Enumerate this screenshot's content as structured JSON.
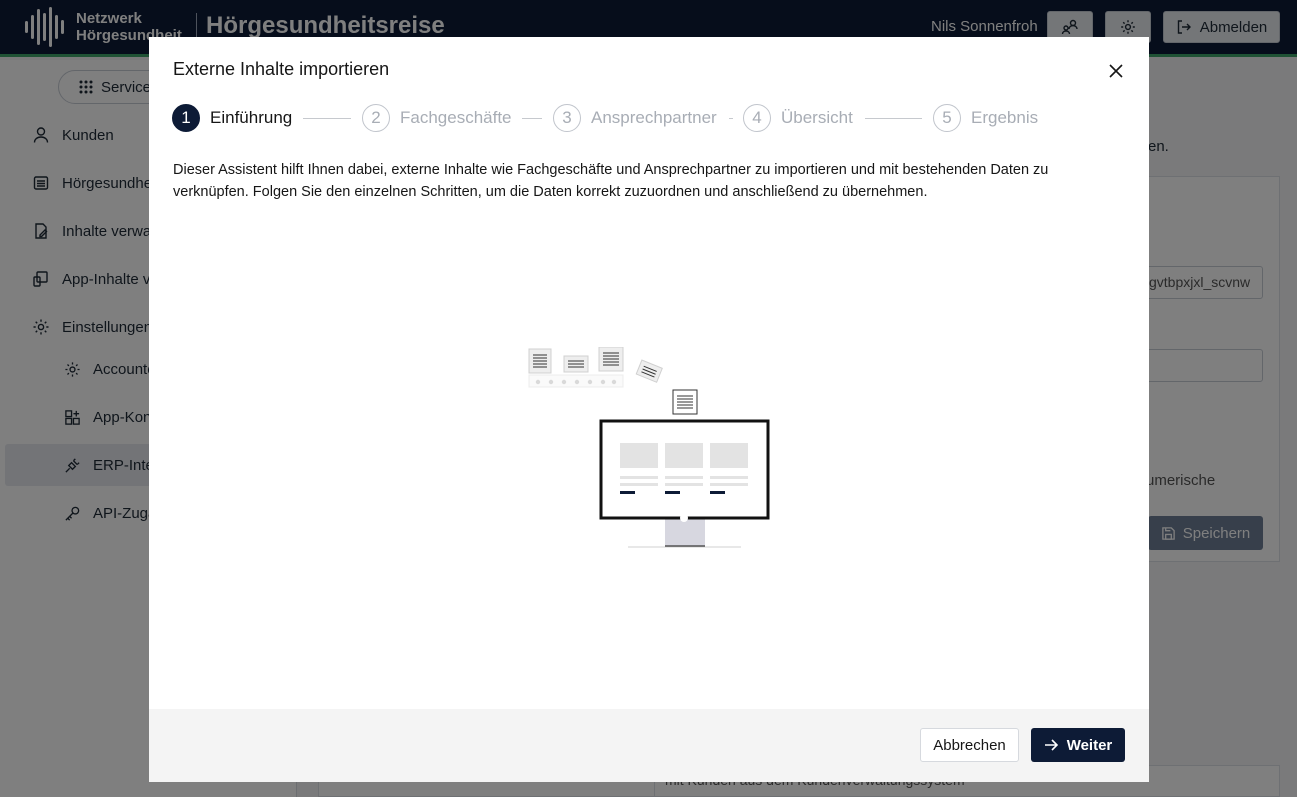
{
  "header": {
    "logo_line1": "Netzwerk",
    "logo_line2": "Hörgesundheit",
    "app_title": "Hörgesundheitsreise",
    "user_name": "Nils Sonnenfroh",
    "logout_label": "Abmelden"
  },
  "sidebar": {
    "service_label": "Service",
    "items": [
      {
        "label": "Kunden",
        "icon": "user-icon"
      },
      {
        "label": "Hörgesundhe",
        "icon": "list-icon"
      },
      {
        "label": "Inhalte verwal",
        "icon": "edit-document-icon"
      },
      {
        "label": "App-Inhalte ve",
        "icon": "app-content-icon"
      },
      {
        "label": "Einstellungen",
        "icon": "gear-icon"
      }
    ],
    "sub_items": [
      {
        "label": "Accounte",
        "icon": "gear-icon"
      },
      {
        "label": "App-Kon",
        "icon": "app-add-icon"
      },
      {
        "label": "ERP-Inte",
        "icon": "plug-icon",
        "active": true
      },
      {
        "label": "API-Zugä",
        "icon": "key-icon"
      }
    ]
  },
  "background": {
    "text_fragment": "en.",
    "input_value": "gvtbpxjxl_scvnw",
    "text_numeric": "umerische",
    "save_label": "Speichern",
    "bottom_cell": "mit Kunden aus dem Kundenverwaltungssystem"
  },
  "modal": {
    "title": "Externe Inhalte importieren",
    "steps": [
      {
        "num": "1",
        "label": "Einführung",
        "active": true
      },
      {
        "num": "2",
        "label": "Fachgeschäfte",
        "active": false
      },
      {
        "num": "3",
        "label": "Ansprechpartner",
        "active": false
      },
      {
        "num": "4",
        "label": "Übersicht",
        "active": false
      },
      {
        "num": "5",
        "label": "Ergebnis",
        "active": false
      }
    ],
    "intro_text": "Dieser Assistent hilft Ihnen dabei, externe Inhalte wie Fachgeschäfte und Ansprechpartner zu importieren und mit bestehenden Daten zu verknüpfen. Folgen Sie den einzelnen Schritten, um die Daten korrekt zuzuordnen und anschließend zu übernehmen.",
    "cancel_label": "Abbrechen",
    "next_label": "Weiter"
  },
  "colors": {
    "header_bg": "#0d1b36",
    "accent_green": "#3fa56a",
    "primary": "#0d1b36"
  }
}
